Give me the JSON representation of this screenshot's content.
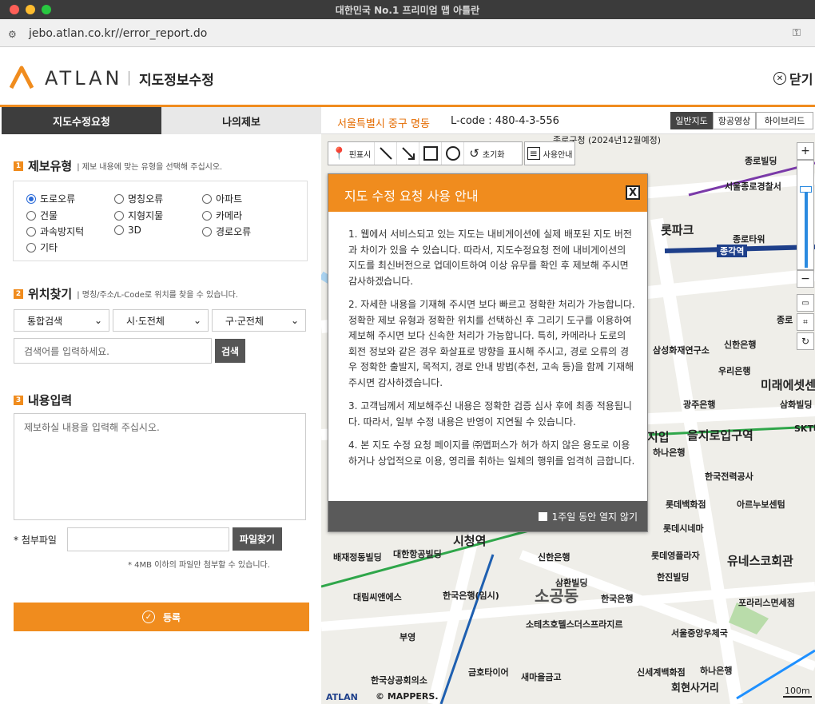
{
  "window": {
    "title": "대한민국 No.1 프리미엄 맵 아틀란",
    "url": "jebo.atlan.co.kr//error_report.do"
  },
  "header": {
    "brand": "ATLAN",
    "subtitle": "지도정보수정",
    "close_label": "닫기"
  },
  "tabs": [
    "지도수정요청",
    "나의제보"
  ],
  "section1": {
    "num": "1",
    "title": "제보유형",
    "desc": "| 제보 내용에 맞는 유형을 선택해 주십시오.",
    "options": [
      "도로오류",
      "명칭오류",
      "아파트",
      "건물",
      "지형지물",
      "카메라",
      "과속방지턱",
      "3D",
      "경로오류",
      "기타"
    ],
    "selected": "도로오류"
  },
  "section2": {
    "num": "2",
    "title": "위치찾기",
    "desc": "| 명칭/주소/L-Code로 위치를 찾을 수 있습니다.",
    "select1": "통합검색",
    "select2": "시·도전체",
    "select3": "구·군전체",
    "search_placeholder": "검색어를 입력하세요.",
    "search_button": "검색"
  },
  "section3": {
    "num": "3",
    "title": "내용입력",
    "content_placeholder": "제보하실 내용을 입력해 주십시오.",
    "attach_label": "* 첨부파일",
    "attach_button": "파일찾기",
    "attach_note": "* 4MB 이하의 파일만 첨부할 수 있습니다."
  },
  "submit_label": "등록",
  "map": {
    "location": "서울특별시 중구 명동",
    "lcode": "L-code : 480-4-3-556",
    "types": [
      "일반지도",
      "항공영상",
      "하이브리드"
    ],
    "tools": {
      "pin": "핀표시",
      "reset": "초기화",
      "guide": "사용안내"
    },
    "labels": [
      "종로빌딩",
      "서울종로경찰서",
      "롯파크",
      "종로타워",
      "종각역",
      "종로",
      "삼성화재연구소",
      "신한은행",
      "우리은행",
      "미래에셋센",
      "광주은행",
      "삼화빌딩",
      "SKT타",
      "을지로입구역",
      "지입",
      "하나은행",
      "한국전력공사",
      "롯데백화점",
      "아르누보센텀",
      "롯데시네마",
      "롯데영플라자",
      "유네스코회관",
      "한진빌딩",
      "포라리스면세점",
      "시청역",
      "배재정동빌딩",
      "대한항공빌딩",
      "신한은행",
      "삼환빌딩",
      "소공동",
      "대림씨앤에스",
      "한국은행(임시)",
      "한국은행",
      "소테츠호텔스더스프라지르",
      "부영",
      "서울중앙우체국",
      "신세계백화점",
      "하나은행",
      "한국상공회의소",
      "금호타이어",
      "새마을금고",
      "회현사거리",
      "종로구청 (2024년12월예정)"
    ],
    "copyright": "© MAPPERS.",
    "scale": "100m"
  },
  "modal": {
    "title": "지도 수정 요청 사용 안내",
    "close": "X",
    "paragraphs": [
      "1. 웹에서 서비스되고 있는 지도는 내비게이션에 실제 배포된 지도 버전과 차이가 있을 수 있습니다. 따라서, 지도수정요청 전에 내비게이션의 지도를 최신버전으로 업데이트하여 이상 유무를 확인 후 제보해 주시면 감사하겠습니다.",
      "2. 자세한 내용을 기재해 주시면 보다 빠르고 정확한 처리가 가능합니다. 정확한 제보 유형과 정확한 위치를 선택하신 후 그리기 도구를 이용하여 제보해 주시면 보다 신속한 처리가 가능합니다. 특히, 카메라나 도로의 회전 정보와 같은 경우 화살표로 방향을 표시해 주시고, 경로 오류의 경우 정확한 출발지, 목적지, 경로 안내 방법(추천, 고속 등)을 함께 기재해 주시면 감사하겠습니다.",
      "3. 고객님께서 제보해주신 내용은 정확한 검증 심사 후에 최종 적용됩니다. 따라서, 일부 수정 내용은 반영이 지연될 수 있습니다.",
      "4. 본 지도 수정 요청 페이지를 ㈜맵퍼스가 허가 하지 않은 용도로 이용하거나 상업적으로 이용, 영리를 취하는 일체의 행위를 엄격히 금합니다."
    ],
    "footer": "1주일 동안 열지 않기"
  }
}
